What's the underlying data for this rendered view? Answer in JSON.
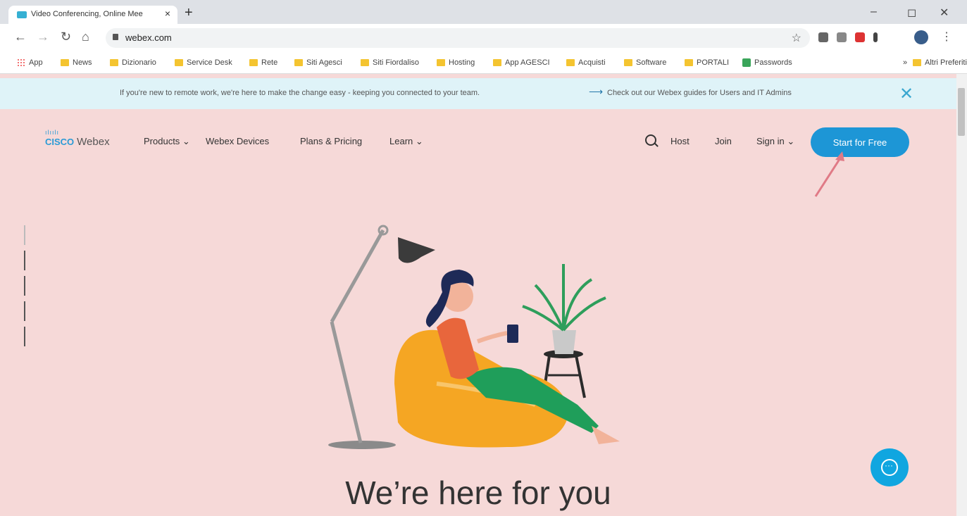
{
  "browser": {
    "tab_title": "Video Conferencing, Online Mee",
    "tab_close": "×",
    "new_tab": "+",
    "url": "webex.com"
  },
  "bookmarks": [
    {
      "label": "App",
      "icon": "apps-icon"
    },
    {
      "label": "News",
      "icon": "folder-icon"
    },
    {
      "label": "Dizionario",
      "icon": "folder-icon"
    },
    {
      "label": "Service Desk",
      "icon": "folder-icon"
    },
    {
      "label": "Rete",
      "icon": "folder-icon"
    },
    {
      "label": "Siti Agesci",
      "icon": "folder-icon"
    },
    {
      "label": "Siti Fiordaliso",
      "icon": "folder-icon"
    },
    {
      "label": "Hosting",
      "icon": "folder-icon"
    },
    {
      "label": "App AGESCI",
      "icon": "folder-icon"
    },
    {
      "label": "Acquisti",
      "icon": "folder-icon"
    },
    {
      "label": "Software",
      "icon": "folder-icon"
    },
    {
      "label": "PORTALI",
      "icon": "folder-icon"
    },
    {
      "label": "Passwords",
      "icon": "password-icon"
    }
  ],
  "bookmarks_more": "»",
  "bookmarks_other": "Altri Preferiti",
  "banner": {
    "message": "If you're new to remote work, we're here to make the change easy - keeping you connected to your team.",
    "link": "Check out our Webex guides for Users and IT Admins"
  },
  "header": {
    "logo_bars": "ılıılı",
    "logo_cisco": "CISCO",
    "logo_product": "Webex",
    "nav": {
      "products": "Products ⌄",
      "devices": "Webex Devices",
      "pricing": "Plans & Pricing",
      "learn": "Learn ⌄"
    },
    "host": "Host",
    "join": "Join",
    "sign_in": "Sign in ⌄",
    "cta": "Start for Free"
  },
  "hero": {
    "headline": "We’re here for you"
  },
  "colors": {
    "page_bg": "#f6d9d8",
    "accent": "#1d96d6",
    "banner_bg": "#dff3f8"
  }
}
